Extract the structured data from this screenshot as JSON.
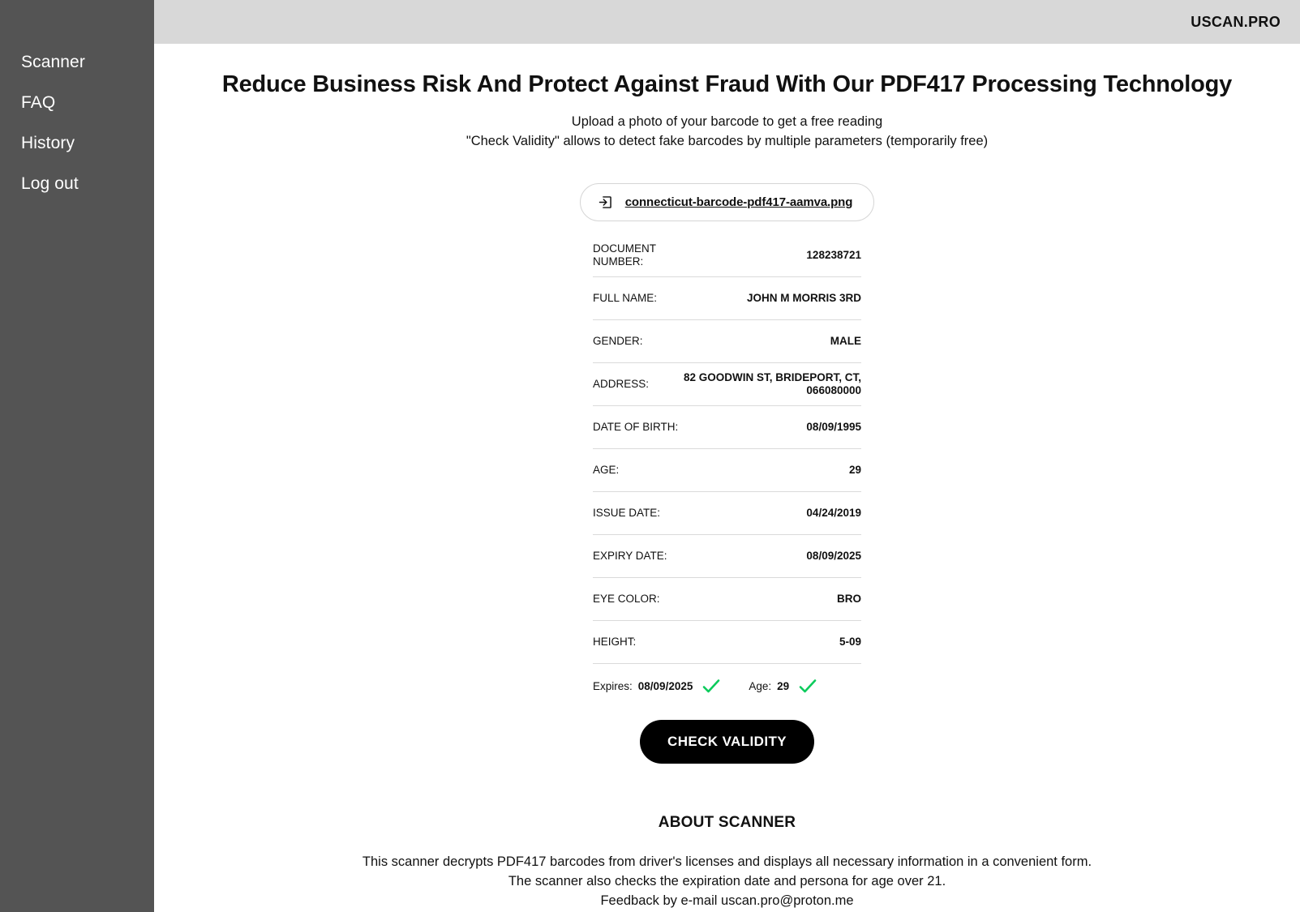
{
  "sidebar": {
    "items": [
      {
        "label": "Scanner",
        "name": "sidebar-item-scanner"
      },
      {
        "label": "FAQ",
        "name": "sidebar-item-faq"
      },
      {
        "label": "History",
        "name": "sidebar-item-history"
      },
      {
        "label": "Log out",
        "name": "sidebar-item-log-out"
      }
    ]
  },
  "header": {
    "brand": "USCAN.PRO",
    "background": "#d8d8d8"
  },
  "main": {
    "title": "Reduce Business Risk And Protect Against Fraud With Our PDF417 Processing Technology",
    "lead_line_1": "Upload a photo of your barcode to get a free reading",
    "lead_line_2": "\"Check Validity\" allows to detect fake barcodes by multiple parameters (temporarily free)"
  },
  "upload": {
    "icon": "import-arrow-icon",
    "file_name": "connecticut-barcode-pdf417-aamva.png"
  },
  "fields": [
    {
      "label": "DOCUMENT\nNUMBER:",
      "value": "128238721",
      "name": "field-document-number"
    },
    {
      "label": "FULL NAME:",
      "value": "JOHN M MORRIS 3RD",
      "name": "field-full-name"
    },
    {
      "label": "GENDER:",
      "value": "MALE",
      "name": "field-gender"
    },
    {
      "label": "ADDRESS:",
      "value": "82 GOODWIN ST, BRIDEPORT,\nCT, 066080000",
      "name": "field-address"
    },
    {
      "label": "DATE OF BIRTH:",
      "value": "08/09/1995",
      "name": "field-date-of-birth"
    },
    {
      "label": "AGE:",
      "value": "29",
      "name": "field-age"
    },
    {
      "label": "ISSUE DATE:",
      "value": "04/24/2019",
      "name": "field-issue-date"
    },
    {
      "label": "EXPIRY DATE:",
      "value": "08/09/2025",
      "name": "field-expiry-date"
    },
    {
      "label": "EYE COLOR:",
      "value": "BRO",
      "name": "field-eye-color"
    },
    {
      "label": "HEIGHT:",
      "value": "5-09",
      "name": "field-height"
    }
  ],
  "validation": {
    "check_color": "#0ccb5c",
    "expires_label": "Expires:",
    "expires_value": "08/09/2025",
    "age_label": "Age:",
    "age_value": "29"
  },
  "cta": {
    "label": "CHECK VALIDITY",
    "background": "#000000",
    "text_color": "#ffffff"
  },
  "about": {
    "title": "ABOUT SCANNER",
    "line_1": "This scanner decrypts PDF417 barcodes from driver's licenses and displays all necessary information in a convenient form.",
    "line_2": "The scanner also checks the expiration date and persona for age over 21.",
    "line_3": "Feedback by e-mail uscan.pro@proton.me"
  }
}
